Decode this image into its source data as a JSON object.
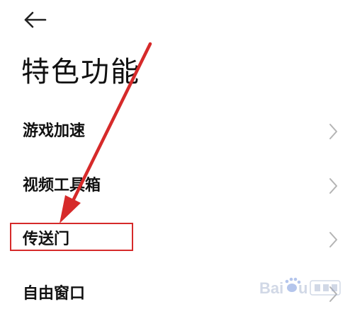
{
  "header": {
    "back_icon": "arrow-left-icon",
    "title": "特色功能"
  },
  "menu": {
    "items": [
      {
        "label": "游戏加速",
        "icon": "chevron-right-icon"
      },
      {
        "label": "视频工具箱",
        "icon": "chevron-right-icon"
      },
      {
        "label": "传送门",
        "icon": "chevron-right-icon"
      },
      {
        "label": "自由窗口",
        "icon": "chevron-right-icon"
      }
    ]
  },
  "annotation": {
    "color": "#d62a2a",
    "highlighted_item": "传送门"
  },
  "watermark": {
    "text": "Baidu 经验"
  },
  "colors": {
    "text": "#111111",
    "chevron": "#b4b4b4",
    "annotation": "#d62a2a"
  }
}
